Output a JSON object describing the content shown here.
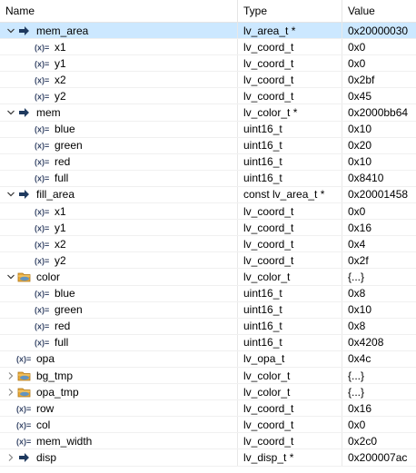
{
  "columns": {
    "name": "Name",
    "type": "Type",
    "value": "Value"
  },
  "rows": [
    {
      "name": "mem_area",
      "type": "lv_area_t *",
      "value": "0x20000030",
      "level": 0,
      "expander": "expanded",
      "icon": "pointer-arrow-icon",
      "selected": true
    },
    {
      "name": "x1",
      "type": "lv_coord_t",
      "value": "0x0",
      "level": 1,
      "expander": "none",
      "icon": "variable-icon"
    },
    {
      "name": "y1",
      "type": "lv_coord_t",
      "value": "0x0",
      "level": 1,
      "expander": "none",
      "icon": "variable-icon"
    },
    {
      "name": "x2",
      "type": "lv_coord_t",
      "value": "0x2bf",
      "level": 1,
      "expander": "none",
      "icon": "variable-icon"
    },
    {
      "name": "y2",
      "type": "lv_coord_t",
      "value": "0x45",
      "level": 1,
      "expander": "none",
      "icon": "variable-icon"
    },
    {
      "name": "mem",
      "type": "lv_color_t *",
      "value": "0x2000bb64",
      "level": 0,
      "expander": "expanded",
      "icon": "pointer-arrow-icon"
    },
    {
      "name": "blue",
      "type": "uint16_t",
      "value": "0x10",
      "level": 1,
      "expander": "none",
      "icon": "variable-icon"
    },
    {
      "name": "green",
      "type": "uint16_t",
      "value": "0x20",
      "level": 1,
      "expander": "none",
      "icon": "variable-icon"
    },
    {
      "name": "red",
      "type": "uint16_t",
      "value": "0x10",
      "level": 1,
      "expander": "none",
      "icon": "variable-icon"
    },
    {
      "name": "full",
      "type": "uint16_t",
      "value": "0x8410",
      "level": 1,
      "expander": "none",
      "icon": "variable-icon"
    },
    {
      "name": "fill_area",
      "type": "const lv_area_t *",
      "value": "0x20001458",
      "level": 0,
      "expander": "expanded",
      "icon": "pointer-arrow-icon"
    },
    {
      "name": "x1",
      "type": "lv_coord_t",
      "value": "0x0",
      "level": 1,
      "expander": "none",
      "icon": "variable-icon"
    },
    {
      "name": "y1",
      "type": "lv_coord_t",
      "value": "0x16",
      "level": 1,
      "expander": "none",
      "icon": "variable-icon"
    },
    {
      "name": "x2",
      "type": "lv_coord_t",
      "value": "0x4",
      "level": 1,
      "expander": "none",
      "icon": "variable-icon"
    },
    {
      "name": "y2",
      "type": "lv_coord_t",
      "value": "0x2f",
      "level": 1,
      "expander": "none",
      "icon": "variable-icon"
    },
    {
      "name": "color",
      "type": "lv_color_t",
      "value": "{...}",
      "level": 0,
      "expander": "expanded",
      "icon": "struct-icon"
    },
    {
      "name": "blue",
      "type": "uint16_t",
      "value": "0x8",
      "level": 1,
      "expander": "none",
      "icon": "variable-icon"
    },
    {
      "name": "green",
      "type": "uint16_t",
      "value": "0x10",
      "level": 1,
      "expander": "none",
      "icon": "variable-icon"
    },
    {
      "name": "red",
      "type": "uint16_t",
      "value": "0x8",
      "level": 1,
      "expander": "none",
      "icon": "variable-icon"
    },
    {
      "name": "full",
      "type": "uint16_t",
      "value": "0x4208",
      "level": 1,
      "expander": "none",
      "icon": "variable-icon"
    },
    {
      "name": "opa",
      "type": "lv_opa_t",
      "value": "0x4c",
      "level": 0,
      "expander": "none",
      "icon": "variable-icon"
    },
    {
      "name": "bg_tmp",
      "type": "lv_color_t",
      "value": "{...}",
      "level": 0,
      "expander": "collapsed",
      "icon": "struct-icon"
    },
    {
      "name": "opa_tmp",
      "type": "lv_color_t",
      "value": "{...}",
      "level": 0,
      "expander": "collapsed",
      "icon": "struct-icon"
    },
    {
      "name": "row",
      "type": "lv_coord_t",
      "value": "0x16",
      "level": 0,
      "expander": "none",
      "icon": "variable-icon"
    },
    {
      "name": "col",
      "type": "lv_coord_t",
      "value": "0x0",
      "level": 0,
      "expander": "none",
      "icon": "variable-icon"
    },
    {
      "name": "mem_width",
      "type": "lv_coord_t",
      "value": "0x2c0",
      "level": 0,
      "expander": "none",
      "icon": "variable-icon"
    },
    {
      "name": "disp",
      "type": "lv_disp_t *",
      "value": "0x200007ac",
      "level": 0,
      "expander": "collapsed",
      "icon": "pointer-arrow-icon"
    }
  ],
  "colors": {
    "selection": "#cce8ff",
    "pointer_arrow": "#1f3a5f",
    "struct_folder": "#e8a93a",
    "variable_icon": "#3b4a6b"
  }
}
